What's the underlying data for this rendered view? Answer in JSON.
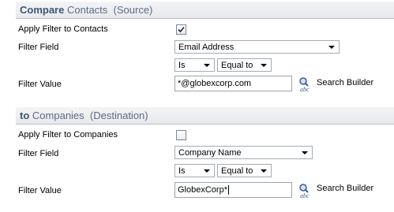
{
  "source": {
    "header_strong": "Compare",
    "header_rest": "Contacts",
    "header_paren": "(Source)",
    "apply_filter_label": "Apply Filter to Contacts",
    "apply_filter_checked": true,
    "filter_field_label": "Filter Field",
    "filter_field_value": "Email Address",
    "operator_value": "Is",
    "comparison_value": "Equal to",
    "filter_value_label": "Filter Value",
    "filter_value": "*@globexcorp.com",
    "search_builder_label": "Search Builder"
  },
  "destination": {
    "header_strong": "to",
    "header_rest": "Companies",
    "header_paren": "(Destination)",
    "apply_filter_label": "Apply Filter to Companies",
    "apply_filter_checked": false,
    "filter_field_label": "Filter Field",
    "filter_field_value": "Company Name",
    "operator_value": "Is",
    "comparison_value": "Equal to",
    "filter_value_label": "Filter Value",
    "filter_value": "GlobexCorp*",
    "search_builder_label": "Search Builder"
  },
  "icons": {
    "search_builder": "search-builder-icon",
    "checkmark": "checkmark-icon",
    "dropdown": "chevron-down-icon"
  },
  "colors": {
    "header_text": "#5c6d84",
    "header_strong": "#3f5473",
    "header_bg": "#eceef1"
  }
}
